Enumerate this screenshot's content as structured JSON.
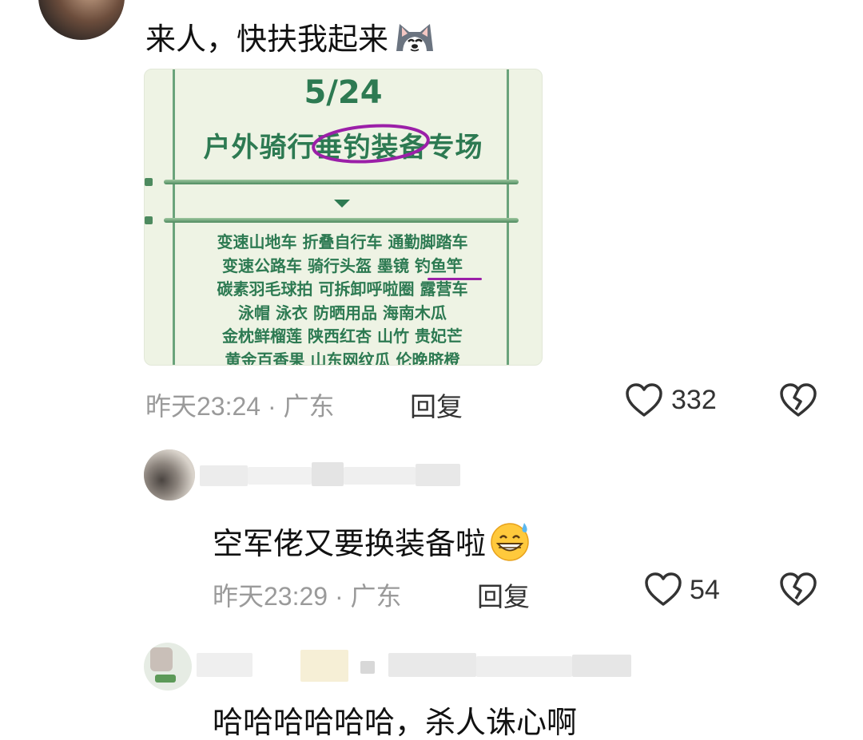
{
  "comments": [
    {
      "text": "来人，快扶我起来",
      "emoji": "husky-dog-emoji",
      "time": "昨天23:24 · 广东",
      "reply": "回复",
      "likes": "332"
    },
    {
      "text": "空军佬又要换装备啦",
      "emoji": "grinning-sweat-emoji",
      "time": "昨天23:29 · 广东",
      "reply": "回复",
      "likes": "54"
    },
    {
      "text": "哈哈哈哈哈哈，杀人诛心啊"
    }
  ],
  "poster": {
    "date": "5/24",
    "headline": "户外骑行垂钓装备专场",
    "items": [
      "变速山地车 折叠自行车 通勤脚踏车",
      "变速公路车 骑行头盔 墨镜 钓鱼竿",
      "碳素羽毛球拍 可拆卸呼啦圈 露营车",
      "泳帽 泳衣 防晒用品 海南木瓜",
      "金枕鲜榴莲 陕西红杏 山竹 贵妃芒",
      "黄金百香果 山东网纹瓜 伦晚脐橙"
    ]
  },
  "colors": {
    "poster_green": "#2d7a52",
    "highlight_purple": "#9b1fa8",
    "meta_gray": "#9a9a9a"
  }
}
